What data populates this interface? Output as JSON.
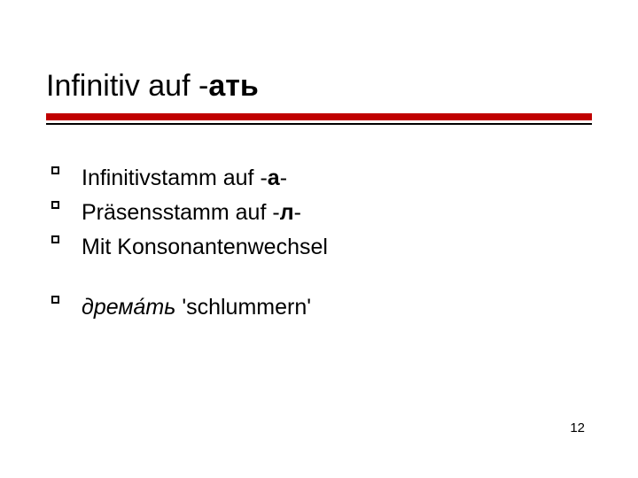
{
  "title": {
    "prefix": "Infinitiv auf -",
    "suffix_bold": "ать"
  },
  "bullets_group1": [
    {
      "pre": "Infinitivstamm auf -",
      "bold": "а",
      "post": "-"
    },
    {
      "pre": "Präsensstamm auf -",
      "bold": "л",
      "post": "-"
    },
    {
      "pre": "Mit Konsonantenwechsel",
      "bold": "",
      "post": ""
    }
  ],
  "bullets_group2": [
    {
      "italic": "дрема́ть",
      "post": " 'schlummern'"
    }
  ],
  "page_number": "12"
}
